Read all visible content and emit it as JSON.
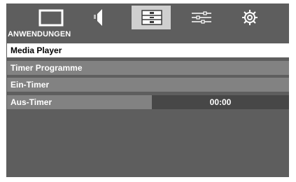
{
  "tabs": [
    {
      "icon": "picture-icon",
      "active": false
    },
    {
      "icon": "sound-icon",
      "active": false
    },
    {
      "icon": "applications-icon",
      "active": true
    },
    {
      "icon": "settings-sliders-icon",
      "active": false
    },
    {
      "icon": "gear-icon",
      "active": false
    }
  ],
  "section": {
    "title": "ANWENDUNGEN"
  },
  "menu": {
    "items": [
      {
        "label": "Media Player",
        "selected": true
      },
      {
        "label": "Timer Programme",
        "selected": false
      },
      {
        "label": "Ein-Timer",
        "selected": false
      },
      {
        "label": "Aus-Timer",
        "selected": false,
        "value": "00:00"
      }
    ]
  },
  "colors": {
    "panel": "#5e5e5e",
    "row": "#828282",
    "row_selected": "#ffffff",
    "value_box": "#474747",
    "active_tab": "#cfcfcf"
  }
}
